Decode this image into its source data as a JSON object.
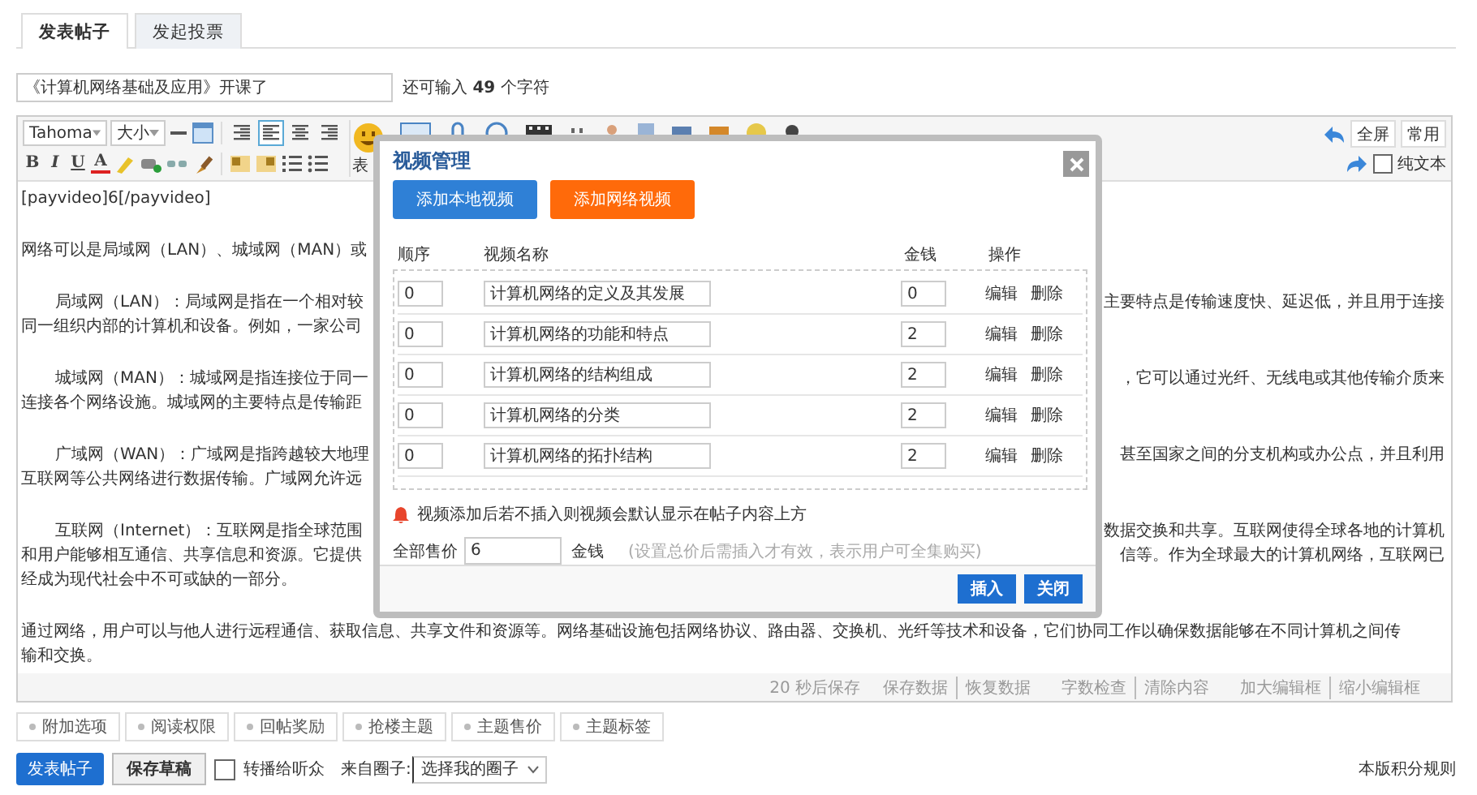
{
  "tabs": [
    {
      "label": "发表帖子",
      "selected": true
    },
    {
      "label": "发起投票",
      "selected": false
    }
  ],
  "subject": {
    "value": "《计算机网络基础及应用》开课了",
    "counter": "还可输入 **49** 个字符"
  },
  "toolbar": {
    "font": "Tahoma",
    "size": "大小",
    "format_buttons": [
      "B",
      "I",
      "U",
      "A"
    ],
    "align_buttons": [
      {
        "kind": "right",
        "selected": false
      },
      {
        "kind": "left",
        "selected": true
      },
      {
        "kind": "center",
        "selected": false
      },
      {
        "kind": "right",
        "selected": false
      }
    ],
    "emoji_label": "表",
    "fullscreen": "全屏",
    "common": "常用",
    "plain_text": {
      "label": "纯文本",
      "checked": false
    }
  },
  "editor": {
    "paragraphs": [
      {
        "indent": false,
        "lines": [
          {
            "left": "[payvideo]6[/payvideo]"
          }
        ]
      },
      {
        "indent": false,
        "lines": [
          {
            "left": "网络可以是局域网（LAN）、城域网（MAN）或"
          }
        ]
      },
      {
        "indent": true,
        "lines": [
          {
            "left": "局域网（LAN）：局域网是指在一个相对较",
            "right": "主要特点是传输速度快、延迟低，并且用于连接"
          },
          {
            "left": "同一组织内部的计算机和设备。例如，一家公司"
          }
        ]
      },
      {
        "indent": true,
        "lines": [
          {
            "left": "城域网（MAN）：城域网是指连接位于同一",
            "right": "，它可以通过光纤、无线电或其他传输介质来"
          },
          {
            "left": "连接各个网络设施。城域网的主要特点是传输距"
          }
        ]
      },
      {
        "indent": true,
        "lines": [
          {
            "left": "广域网（WAN）：广域网是指跨越较大地理",
            "right": "甚至国家之间的分支机构或办公点，并且利用"
          },
          {
            "left": "互联网等公共网络进行数据传输。广域网允许远"
          }
        ]
      },
      {
        "indent": true,
        "lines": [
          {
            "left": "互联网（Internet）：互联网是指全球范围",
            "right": "数据交换和共享。互联网使得全球各地的计算机"
          },
          {
            "left": "和用户能够相互通信、共享信息和资源。它提供",
            "right": "信等。作为全球最大的计算机网络，互联网已"
          },
          {
            "left": "经成为现代社会中不可或缺的一部分。"
          }
        ]
      },
      {
        "indent": false,
        "lines": [
          {
            "left": "通过网络，用户可以与他人进行远程通信、获取信息、共享文件和资源等。网络基础设施包括网络协议、路由器、交换机、光纤等技术和设备，它们协同工作以确保数据能够在不同计算机之间传"
          },
          {
            "left": "输和交换。"
          }
        ]
      }
    ],
    "autosave": "20 秒后保存",
    "status_links": [
      [
        "保存数据",
        "恢复数据"
      ],
      [
        "字数检查",
        "清除内容"
      ],
      [
        "加大编辑框",
        "缩小编辑框"
      ]
    ]
  },
  "video_dialog": {
    "title": "视频管理",
    "add_buttons": [
      {
        "label": "添加本地视频",
        "kind": "local"
      },
      {
        "label": "添加网络视频",
        "kind": "network"
      }
    ],
    "columns": [
      "顺序",
      "视频名称",
      "金钱",
      "操作"
    ],
    "rows": [
      {
        "order": "0",
        "name": "计算机网络的定义及其发展",
        "money": "0",
        "actions": [
          "编辑",
          "删除"
        ]
      },
      {
        "order": "0",
        "name": "计算机网络的功能和特点",
        "money": "2",
        "actions": [
          "编辑",
          "删除"
        ]
      },
      {
        "order": "0",
        "name": "计算机网络的结构组成",
        "money": "2",
        "actions": [
          "编辑",
          "删除"
        ]
      },
      {
        "order": "0",
        "name": "计算机网络的分类",
        "money": "2",
        "actions": [
          "编辑",
          "删除"
        ]
      },
      {
        "order": "0",
        "name": "计算机网络的拓扑结构",
        "money": "2",
        "actions": [
          "编辑",
          "删除"
        ]
      }
    ],
    "note": "视频添加后若不插入则视频会默认显示在帖子内容上方",
    "price": {
      "label": "全部售价",
      "value": "6",
      "unit": "金钱",
      "hint": "(设置总价后需插入才有效，表示用户可全集购买)"
    },
    "footer_buttons": [
      "插入",
      "关闭"
    ]
  },
  "options": [
    "附加选项",
    "阅读权限",
    "回帖奖励",
    "抢楼主题",
    "主题售价",
    "主题标签"
  ],
  "bottom": {
    "submit": "发表帖子",
    "draft": "保存草稿",
    "broadcast": {
      "label": "转播给听众",
      "checked": false
    },
    "circle": {
      "label": "来自圈子:",
      "value": "选择我的圈子"
    },
    "rules": "本版积分规则"
  }
}
